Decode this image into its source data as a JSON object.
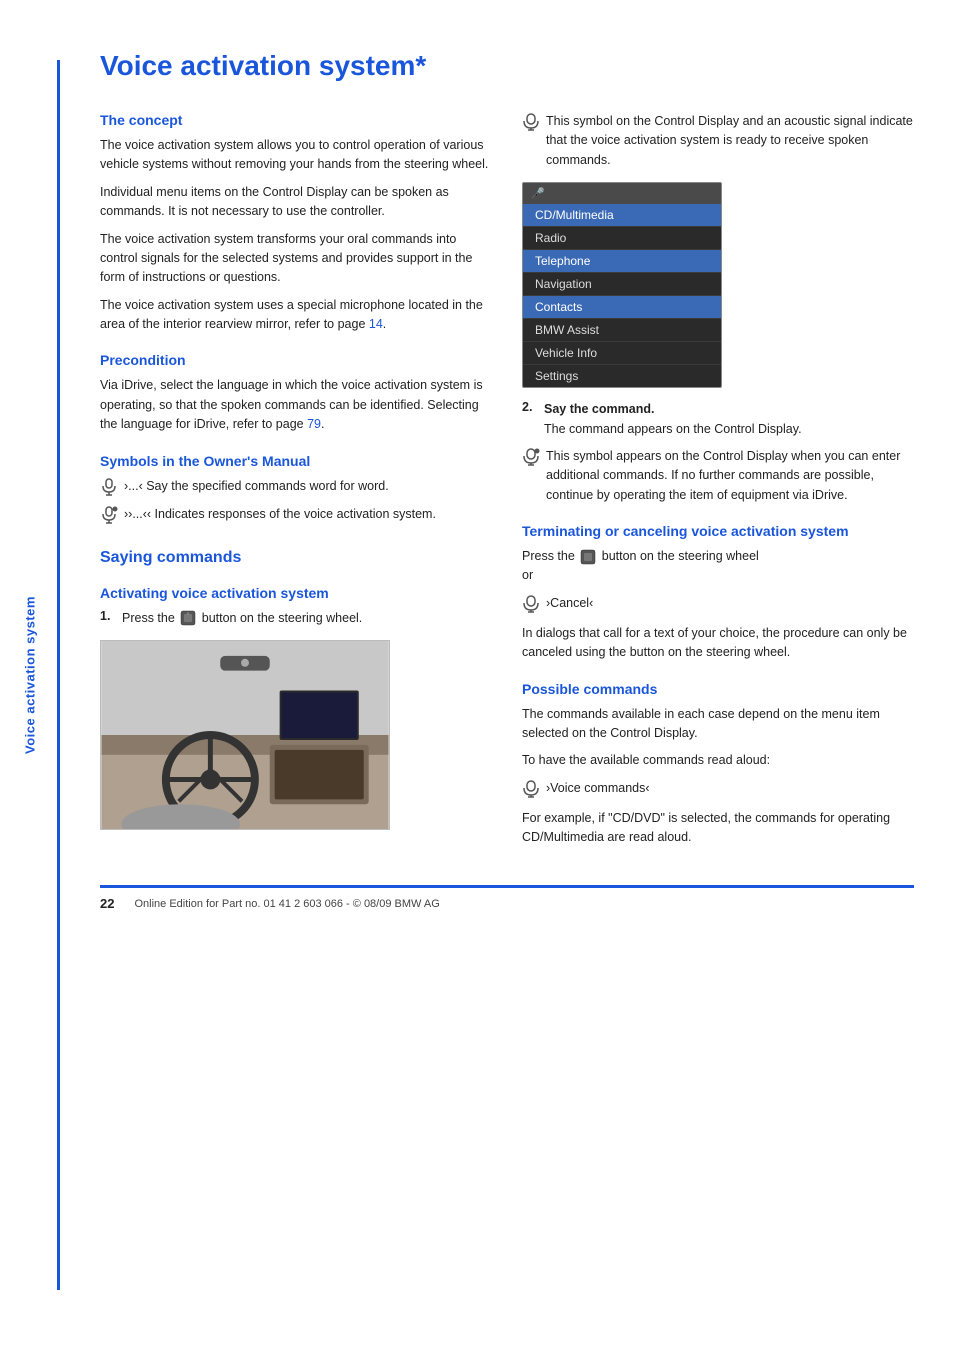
{
  "sidebar": {
    "text": "Voice activation system"
  },
  "page": {
    "title": "Voice activation system*",
    "sections": {
      "concept": {
        "heading": "The concept",
        "paragraphs": [
          "The voice activation system allows you to control operation of various vehicle systems without removing your hands from the steering wheel.",
          "Individual menu items on the Control Display can be spoken as commands. It is not necessary to use the controller.",
          "The voice activation system transforms your oral commands into control signals for the selected systems and provides support in the form of instructions or questions.",
          "The voice activation system uses a special microphone located in the area of the interior rearview mirror, refer to page 14."
        ],
        "precondition": {
          "heading": "Precondition",
          "text": "Via iDrive, select the language in which the voice activation system is operating, so that the spoken commands can be identified. Selecting the language for iDrive, refer to page 79."
        },
        "symbols": {
          "heading": "Symbols in the Owner's Manual",
          "item1_text": "›...‹ Say the specified commands word for word.",
          "item2_text": "›...‹ Indicates responses of the voice activation system."
        }
      },
      "saying_commands": {
        "heading": "Saying commands",
        "activating": {
          "heading": "Activating voice activation system",
          "step1": "Press the",
          "step1_suffix": "button on the steering wheel.",
          "step2_num": "2.",
          "step2_text": "Say the command.",
          "step2_detail": "The command appears on the Control Display."
        },
        "right_col_intro": "This symbol on the Control Display and an acoustic signal indicate that the voice activation system is ready to receive spoken commands.",
        "menu_items": [
          "CD/Multimedia",
          "Radio",
          "Telephone",
          "Navigation",
          "Contacts",
          "BMW Assist",
          "Vehicle Info",
          "Settings"
        ],
        "additional_symbol_text": "This symbol appears on the Control Display when you can enter additional commands. If no further commands are possible, continue by operating the item of equipment via iDrive.",
        "terminating": {
          "heading": "Terminating or canceling voice activation system",
          "text1": "Press the",
          "text1_suffix": "button on the steering wheel",
          "text1_end": "or",
          "cancel_label": "›Cancel‹",
          "text2": "In dialogs that call for a text of your choice, the procedure can only be canceled using the button on the steering wheel."
        },
        "possible_commands": {
          "heading": "Possible commands",
          "text1": "The commands available in each case depend on the menu item selected on the Control Display.",
          "text2": "To have the available commands read aloud:",
          "voice_cmd": "›Voice commands‹",
          "text3": "For example, if \"CD/DVD\" is selected, the commands for operating CD/Multimedia are read aloud."
        }
      }
    },
    "footer": {
      "page_number": "22",
      "copyright": "Online Edition for Part no. 01 41 2 603 066 - © 08/09 BMW AG"
    }
  }
}
